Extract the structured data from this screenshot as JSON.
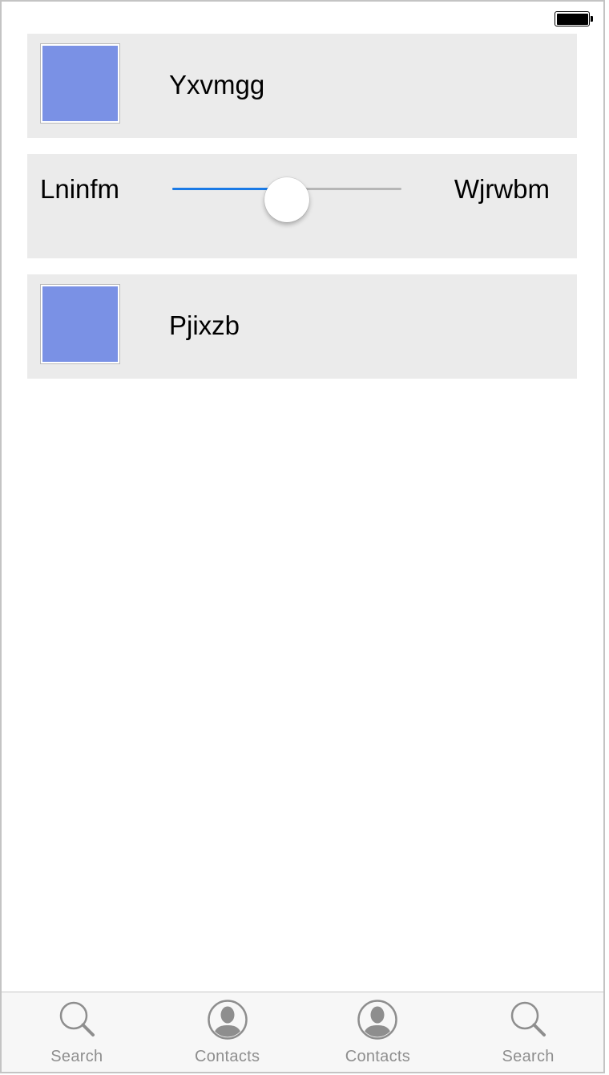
{
  "status_bar": {
    "battery_level": 1.0
  },
  "rows": [
    {
      "type": "image",
      "title": "Yxvmgg",
      "thumb_color": "#7a91e5"
    },
    {
      "type": "slider",
      "min_label": "Lninfm",
      "max_label": "Wjrwbm",
      "value": 0.5
    },
    {
      "type": "image",
      "title": "Pjixzb",
      "thumb_color": "#7a91e5"
    }
  ],
  "tabbar": {
    "items": [
      {
        "label": "Search",
        "icon": "search-icon"
      },
      {
        "label": "Contacts",
        "icon": "contacts-icon"
      },
      {
        "label": "Contacts",
        "icon": "contacts-icon"
      },
      {
        "label": "Search",
        "icon": "search-icon"
      }
    ]
  },
  "colors": {
    "accent": "#1a7ae6",
    "row_background": "#ebebeb",
    "tab_label": "#8e8e8e",
    "icon_gray": "#8e8e8e"
  }
}
